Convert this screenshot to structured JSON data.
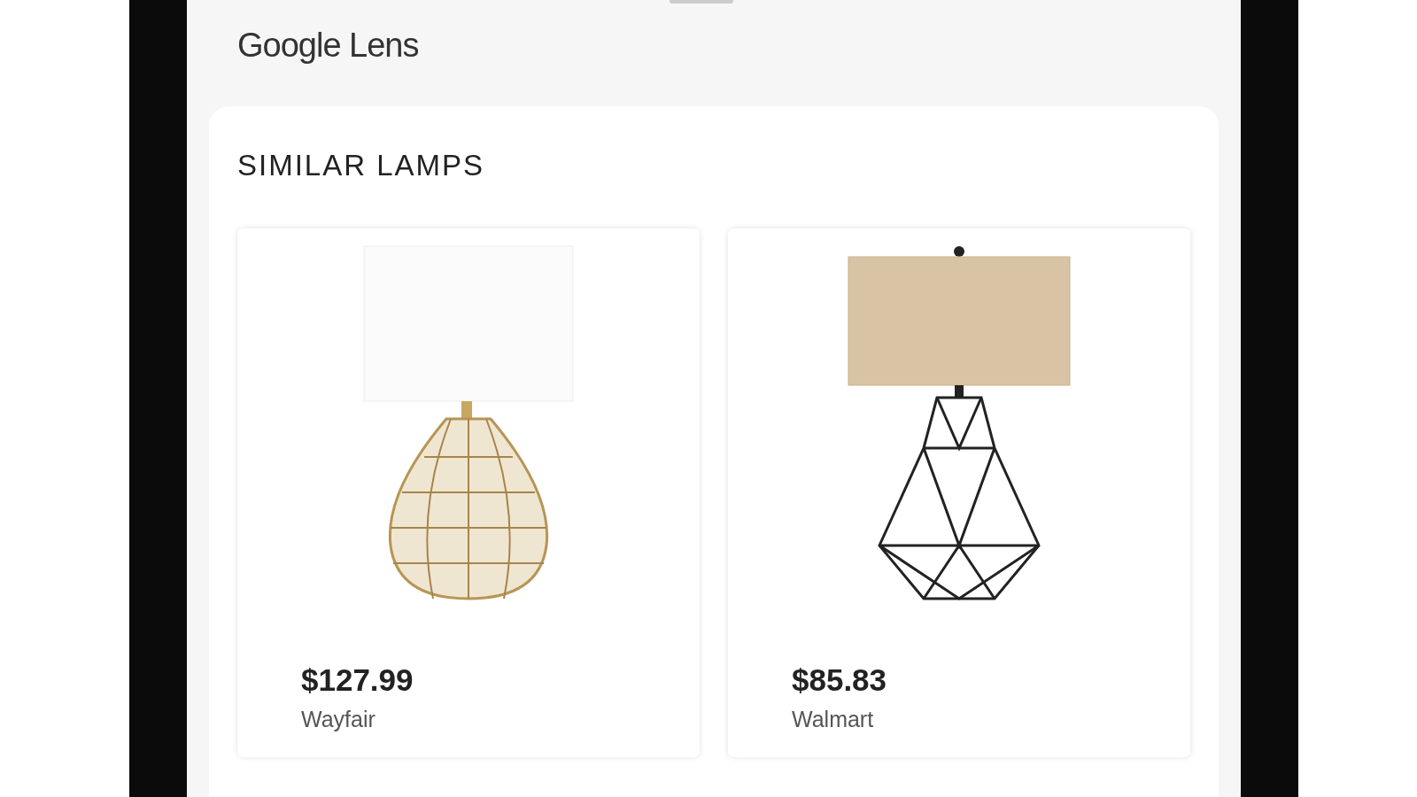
{
  "app": {
    "title": "Google Lens"
  },
  "section": {
    "title": "SIMILAR LAMPS"
  },
  "products": [
    {
      "kind": "cage",
      "price": "$127.99",
      "store": "Wayfair"
    },
    {
      "kind": "geometric",
      "price": "$85.83",
      "store": "Walmart"
    }
  ]
}
